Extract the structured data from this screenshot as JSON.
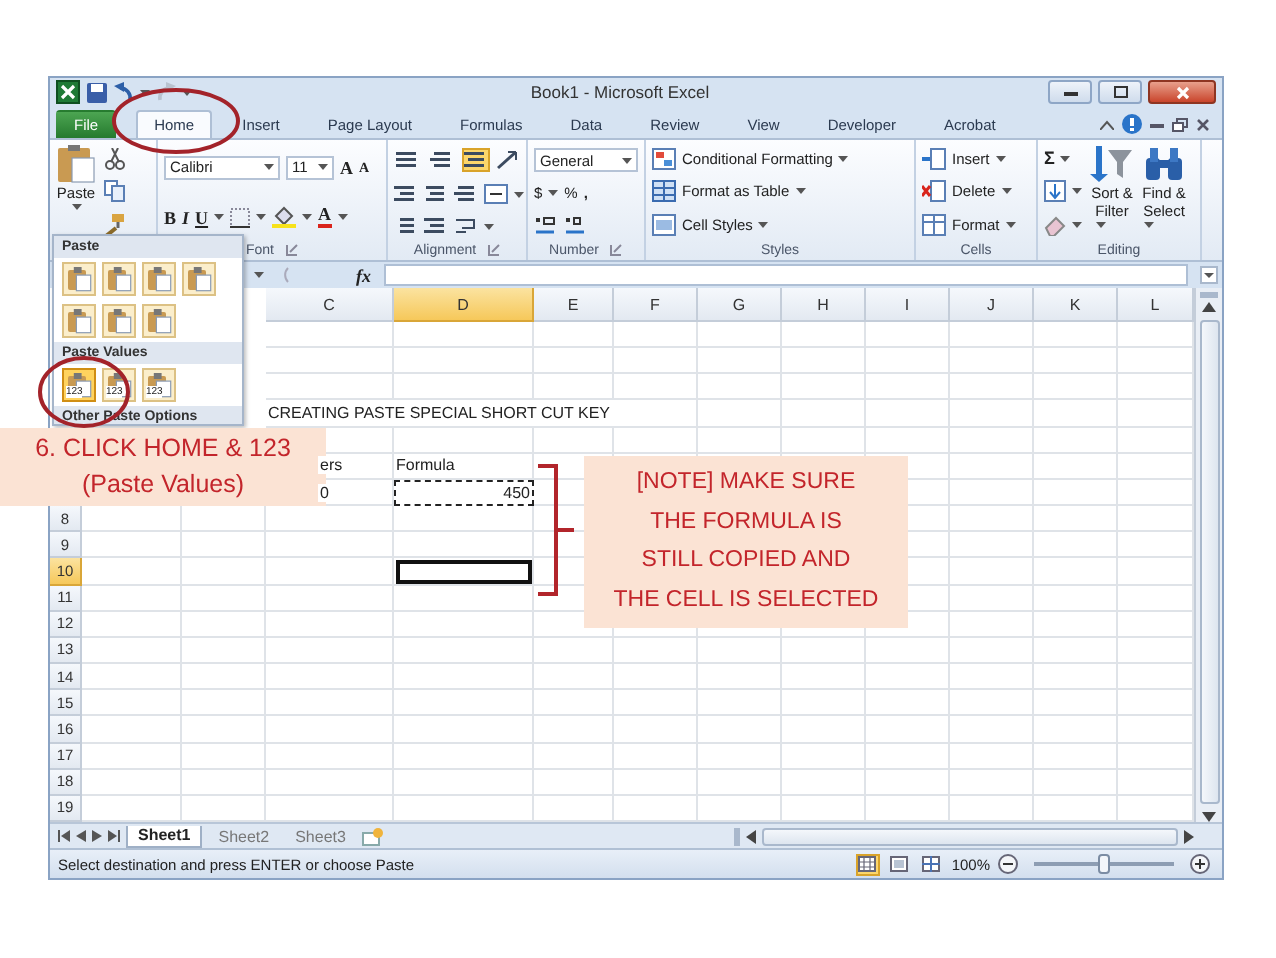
{
  "title_bar": {
    "title": "Book1 - Microsoft Excel"
  },
  "tabs": [
    {
      "label": "File",
      "kind": "file",
      "selected": false
    },
    {
      "label": "Home",
      "kind": "tab",
      "selected": true
    },
    {
      "label": "Insert",
      "kind": "tab",
      "selected": false
    },
    {
      "label": "Page Layout",
      "kind": "tab",
      "selected": false
    },
    {
      "label": "Formulas",
      "kind": "tab",
      "selected": false
    },
    {
      "label": "Data",
      "kind": "tab",
      "selected": false
    },
    {
      "label": "Review",
      "kind": "tab",
      "selected": false
    },
    {
      "label": "View",
      "kind": "tab",
      "selected": false
    },
    {
      "label": "Developer",
      "kind": "tab",
      "selected": false
    },
    {
      "label": "Acrobat",
      "kind": "tab",
      "selected": false
    }
  ],
  "ribbon": [
    {
      "kind": "clipboard",
      "paste_label": "Paste"
    },
    {
      "kind": "font",
      "label": "Font",
      "font_name": "Calibri",
      "font_size": "11",
      "grow": "A",
      "shrink": "A",
      "bold": "B",
      "italic": "I",
      "underline": "U",
      "color_letter": "A"
    },
    {
      "kind": "alignment",
      "label": "Alignment",
      "vertical": [
        {
          "on": false
        },
        {
          "on": false
        },
        {
          "on": true
        }
      ]
    },
    {
      "kind": "number",
      "label": "Number",
      "format": "General",
      "currency": "$",
      "percent": "%",
      "comma": ","
    },
    {
      "kind": "styles",
      "label": "Styles",
      "buttons": [
        "Conditional Formatting",
        "Format as Table",
        "Cell Styles"
      ]
    },
    {
      "kind": "cells",
      "label": "Cells",
      "buttons": [
        "Insert",
        "Delete",
        "Format"
      ]
    },
    {
      "kind": "editing",
      "label": "Editing",
      "sigma": "Σ",
      "sort": [
        "Sort &",
        "Filter"
      ],
      "find": [
        "Find &",
        "Select"
      ]
    }
  ],
  "formula_bar": {
    "fx": "fx"
  },
  "columns": [
    {
      "label": "C",
      "selected": false
    },
    {
      "label": "D",
      "selected": true
    },
    {
      "label": "E",
      "selected": false
    },
    {
      "label": "F",
      "selected": false
    },
    {
      "label": "G",
      "selected": false
    },
    {
      "label": "H",
      "selected": false
    },
    {
      "label": "I",
      "selected": false
    },
    {
      "label": "J",
      "selected": false
    },
    {
      "label": "K",
      "selected": false
    },
    {
      "label": "L",
      "selected": false
    }
  ],
  "rows": [
    {},
    {},
    {},
    {
      "cells": [
        {
          "text": "CREATING PASTE SPECIAL SHORT CUT KEY",
          "kind": "text",
          "selected": false,
          "copied": false
        }
      ]
    },
    {},
    {
      "cells": [
        {
          "text": "ers",
          "kind": "cut",
          "selected": false,
          "copied": false
        },
        {
          "text": "Formula",
          "kind": "text",
          "selected": false,
          "copied": false
        }
      ]
    },
    {
      "cells": [
        {
          "text": "0",
          "kind": "cut",
          "selected": false,
          "copied": false
        },
        {
          "text": "450",
          "kind": "number",
          "selected": false,
          "copied": true
        }
      ]
    },
    {
      "header": "8",
      "selected": false
    },
    {
      "header": "9",
      "selected": false
    },
    {
      "header": "10",
      "selected": true,
      "cells": [
        {},
        {
          "selected": true,
          "copied": false
        }
      ]
    },
    {
      "header": "11",
      "selected": false
    },
    {
      "header": "12",
      "selected": false
    },
    {
      "header": "13",
      "selected": false
    },
    {
      "header": "14",
      "selected": false
    },
    {
      "header": "15",
      "selected": false
    },
    {
      "header": "16",
      "selected": false
    },
    {
      "header": "17",
      "selected": false
    },
    {
      "header": "18",
      "selected": false
    },
    {
      "header": "19",
      "selected": false
    }
  ],
  "sheet_tabs": [
    {
      "label": "Sheet1",
      "selected": true
    },
    {
      "label": "Sheet2",
      "selected": false
    },
    {
      "label": "Sheet3",
      "selected": false
    }
  ],
  "status_bar": {
    "message": "Select destination and press ENTER or choose Paste",
    "views": [
      {
        "selected": true
      },
      {
        "selected": false
      },
      {
        "selected": false
      }
    ],
    "zoom": "100%",
    "level": 0.5
  },
  "paste_menu": {
    "sections": [
      {
        "title": "Paste",
        "rows": [
          [
            {
              "highlighted": false
            },
            {
              "highlighted": false
            },
            {
              "highlighted": false
            },
            {
              "highlighted": false
            }
          ],
          [
            {
              "highlighted": false
            },
            {
              "highlighted": false
            },
            {
              "highlighted": false
            }
          ]
        ]
      },
      {
        "title": "Paste Values",
        "rows": [
          [
            {
              "highlighted": true,
              "label": "123"
            },
            {
              "highlighted": false,
              "label": "123"
            },
            {
              "highlighted": false,
              "label": "123"
            }
          ]
        ]
      },
      {
        "title": "Other Paste Options"
      }
    ]
  },
  "callouts": {
    "step": [
      "6. CLICK HOME & 123",
      "(Paste Values)"
    ],
    "note": [
      "[NOTE] MAKE SURE",
      "THE FORMULA IS",
      "STILL COPIED AND",
      "THE CELL IS SELECTED"
    ]
  }
}
